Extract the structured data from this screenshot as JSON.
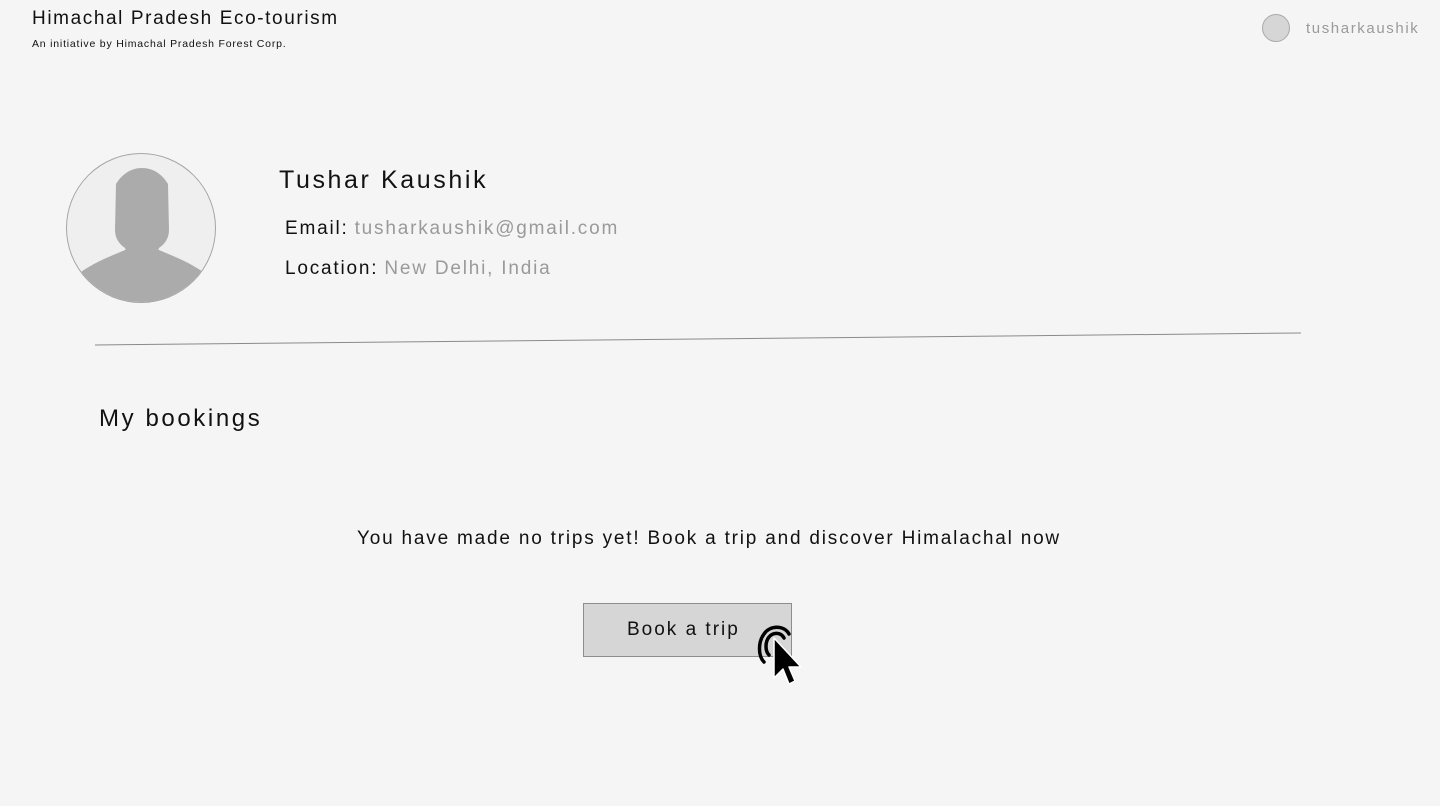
{
  "header": {
    "title": "Himachal Pradesh Eco-tourism",
    "subtitle": "An initiative by Himachal Pradesh Forest Corp.",
    "username": "tusharkaushik"
  },
  "profile": {
    "name": "Tushar Kaushik",
    "email_label": "Email:",
    "email": "tusharkaushik@gmail.com",
    "location_label": "Location:",
    "location": "New Delhi, India"
  },
  "bookings": {
    "heading": "My bookings",
    "empty_message": "You have made no trips yet! Book a trip and discover Himalachal now",
    "button_label": "Book a trip"
  },
  "icons": {
    "avatar": "user-silhouette-icon",
    "cursor": "hand-pointer-cursor-icon"
  },
  "colors": {
    "background": "#f5f5f5",
    "muted_text": "#9a9a9a",
    "button_fill": "#d6d6d6",
    "avatar_figure": "#ababab"
  }
}
